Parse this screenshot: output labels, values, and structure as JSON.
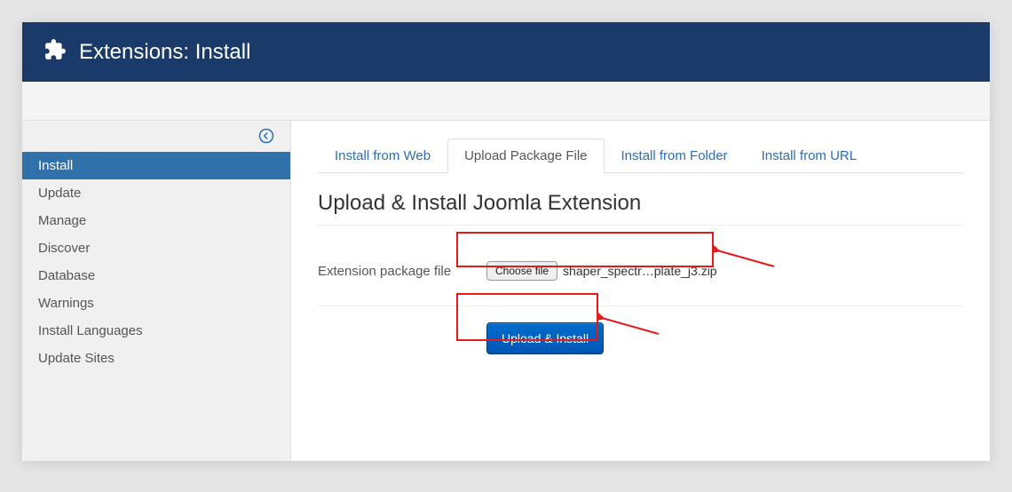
{
  "header": {
    "title": "Extensions: Install"
  },
  "sidebar": {
    "items": [
      {
        "label": "Install",
        "active": true
      },
      {
        "label": "Update",
        "active": false
      },
      {
        "label": "Manage",
        "active": false
      },
      {
        "label": "Discover",
        "active": false
      },
      {
        "label": "Database",
        "active": false
      },
      {
        "label": "Warnings",
        "active": false
      },
      {
        "label": "Install Languages",
        "active": false
      },
      {
        "label": "Update Sites",
        "active": false
      }
    ]
  },
  "tabs": [
    {
      "label": "Install from Web",
      "active": false
    },
    {
      "label": "Upload Package File",
      "active": true
    },
    {
      "label": "Install from Folder",
      "active": false
    },
    {
      "label": "Install from URL",
      "active": false
    }
  ],
  "main": {
    "section_title": "Upload & Install Joomla Extension",
    "file_label": "Extension package file",
    "choose_file_label": "Choose file",
    "chosen_filename": "shaper_spectr…plate_j3.zip",
    "upload_button_label": "Upload & Install"
  }
}
